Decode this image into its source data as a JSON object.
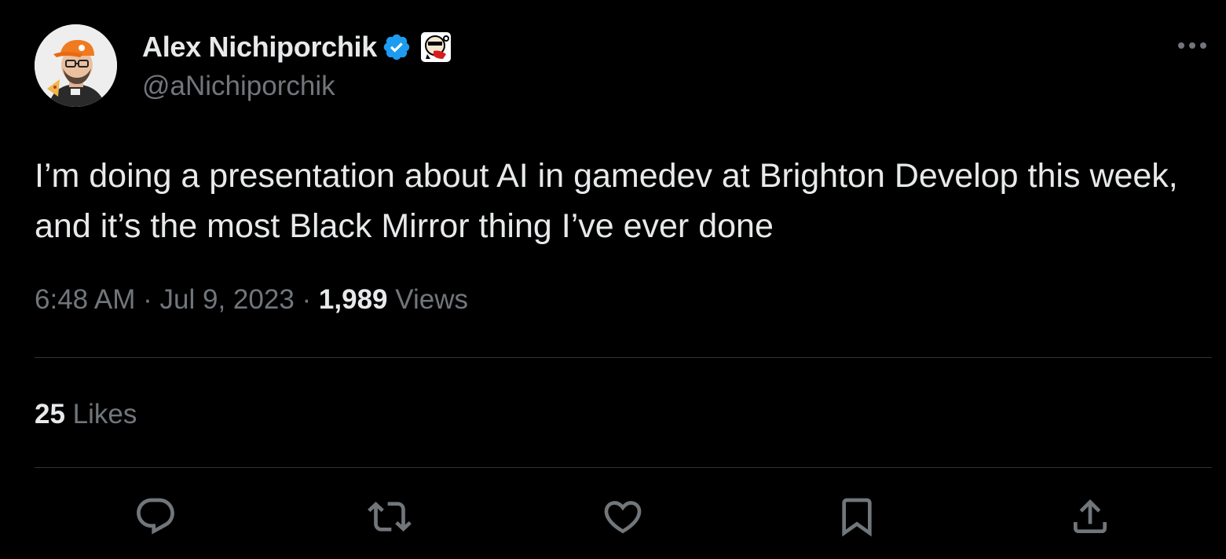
{
  "author": {
    "display_name": "Alex Nichiporchik",
    "handle": "@aNichiporchik",
    "verified_icon": "verified-badge-icon",
    "affiliation_icon": "affiliate-badge-icon"
  },
  "tweet": {
    "text": "I’m doing a presentation about AI in gamedev at Brighton Develop this week, and it’s the most Black Mirror thing I’ve ever done",
    "time": "6:48 AM",
    "separator": "·",
    "date": "Jul 9, 2023",
    "views_count": "1,989",
    "views_label": "Views"
  },
  "stats": {
    "likes_count": "25",
    "likes_label": "Likes"
  },
  "actions": [
    "reply-icon",
    "retweet-icon",
    "like-icon",
    "bookmark-icon",
    "share-icon"
  ],
  "colors": {
    "background": "#000000",
    "text_primary": "#e7e9ea",
    "text_secondary": "#71767b",
    "divider": "#2f3336",
    "verified_blue": "#1d9bf0"
  }
}
